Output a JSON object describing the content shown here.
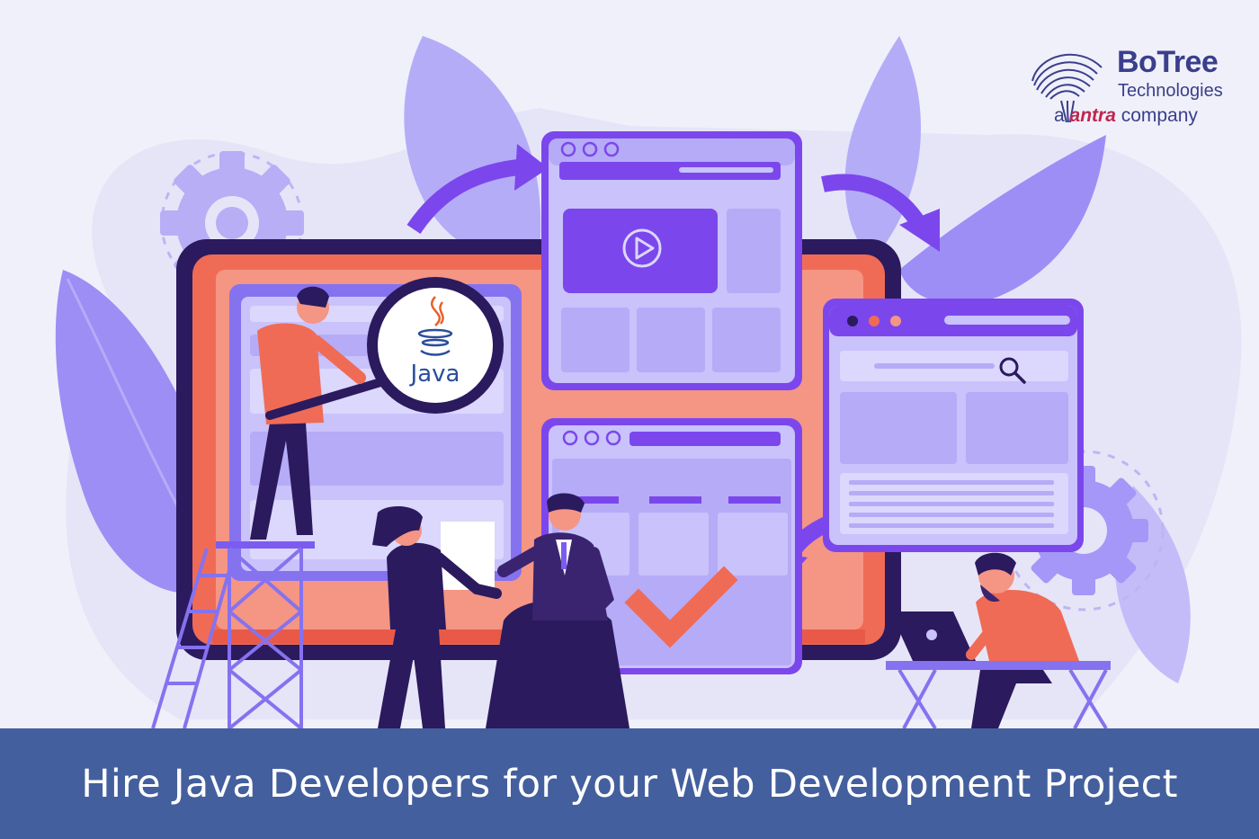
{
  "banner": {
    "title": "Hire Java Developers for your Web Development Project"
  },
  "logo": {
    "name": "BoTree",
    "subtitle": "Technologies",
    "tagline_prefix": "a ",
    "tagline_brand": "antra",
    "tagline_suffix": " company"
  },
  "magnifier": {
    "label": "Java"
  },
  "icons": {
    "main": "java-logo-icon",
    "play": "play-icon",
    "search": "search-icon",
    "check": "checkmark-icon",
    "gear": "gear-icon"
  },
  "colors": {
    "background": "#f0f0fa",
    "primary_purple": "#7b5cf0",
    "light_purple": "#c9c2fb",
    "dark_navy": "#2b1a5e",
    "coral": "#f06b55",
    "banner": "#445f9e",
    "logo_blue": "#3a3f8c"
  }
}
